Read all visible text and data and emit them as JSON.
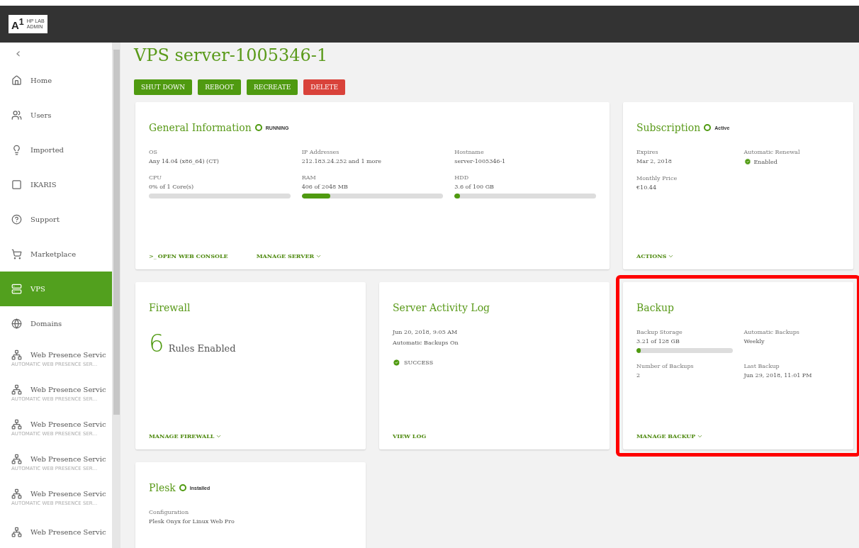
{
  "header": {
    "logo_mark": "A$^{1}$",
    "logo_lines": [
      "HP LAB",
      "ADMIN"
    ]
  },
  "sidebar": {
    "collapse": "‹",
    "items": [
      {
        "kind": "home",
        "label": "Home",
        "selected": false
      },
      {
        "kind": "users",
        "label": "Users",
        "selected": false
      },
      {
        "kind": "bulb",
        "label": "Imported",
        "selected": false
      },
      {
        "kind": "square",
        "label": "IKARIS",
        "selected": false
      },
      {
        "kind": "help",
        "label": "Support",
        "selected": false
      },
      {
        "kind": "cart",
        "label": "Marketplace",
        "selected": false
      },
      {
        "kind": "server",
        "label": "VPS",
        "selected": true
      },
      {
        "kind": "globe",
        "label": "Domains",
        "selected": false
      },
      {
        "kind": "network",
        "label": "Web Presence Servic",
        "sub": "AUTOMATIC WEB PRESENCE SER...",
        "selected": false
      },
      {
        "kind": "network",
        "label": "Web Presence Servic",
        "sub": "AUTOMATIC WEB PRESENCE SER...",
        "selected": false
      },
      {
        "kind": "network",
        "label": "Web Presence Servic",
        "sub": "AUTOMATIC WEB PRESENCE SER...",
        "selected": false
      },
      {
        "kind": "network",
        "label": "Web Presence Servic",
        "sub": "AUTOMATIC WEB PRESENCE SER...",
        "selected": false
      },
      {
        "kind": "network",
        "label": "Web Presence Servic",
        "sub": "AUTOMATIC WEB PRESENCE SER...",
        "selected": false
      },
      {
        "kind": "network",
        "label": "Web Presence Servic",
        "selected": false
      }
    ]
  },
  "title": "VPS server-1005346-1",
  "buttons": [
    {
      "label": "SHUT DOWN",
      "kind": "primary"
    },
    {
      "label": "REBOOT",
      "kind": "primary"
    },
    {
      "label": "RECREATE",
      "kind": "primary"
    },
    {
      "label": "DELETE",
      "kind": "danger"
    }
  ],
  "cards": [
    {
      "title": "General Information",
      "status": "RUNNING",
      "highlighted": false,
      "fields": [
        {
          "label": "OS",
          "value": "Any 14.04 (x86_64) (CT)"
        },
        {
          "label": "IP Addresses",
          "value": "212.183.24.252 and 1 more"
        },
        {
          "label": "Hostname",
          "value": "server-1005346-1"
        },
        {
          "label": "CPU",
          "value": "0% of 1 Core(s)",
          "level": 0
        },
        {
          "label": "RAM",
          "value": "406 of 2048 MB",
          "level": 0.2
        },
        {
          "label": "HDD",
          "value": "3.6 of 100 GB",
          "level": 0.036
        }
      ],
      "actions": [
        {
          "label": "OPEN WEB CONSOLE",
          "kind": "console",
          "prefix": ">_"
        },
        {
          "label": "MANAGE SERVER",
          "kind": "menu"
        }
      ]
    },
    {
      "title": "Subscription",
      "status": "Active",
      "highlighted": false,
      "fields": [
        {
          "label": "Expires",
          "value": "Mar 2, 2018"
        },
        {
          "label": "Automatic Renewal",
          "value": "Enabled",
          "check": true
        },
        {
          "label": "Monthly Price",
          "value": "€10.44"
        }
      ],
      "actions": [
        {
          "label": "ACTIONS",
          "kind": "menu"
        }
      ]
    },
    {
      "title": "Firewall",
      "highlighted": false,
      "big": {
        "number": "6",
        "text": "Rules Enabled"
      },
      "actions": [
        {
          "label": "MANAGE FIREWALL",
          "kind": "menu"
        }
      ]
    },
    {
      "title": "Server Activity Log",
      "highlighted": false,
      "lines": [
        "Jun 20, 2018, 9:05 AM",
        "Automatic Backups On"
      ],
      "result": "SUCCESS",
      "actions": [
        {
          "label": "VIEW LOG",
          "kind": "link"
        }
      ]
    },
    {
      "title": "Backup",
      "highlighted": true,
      "fields": [
        {
          "label": "Backup Storage",
          "value": "3.21 of 128 GB",
          "level": 0.02
        },
        {
          "label": "Automatic Backups",
          "value": "Weekly"
        },
        {
          "label": "Number of Backups",
          "value": "2"
        },
        {
          "label": "Last Backup",
          "value": "Jun 29, 2018, 11:01 PM"
        }
      ],
      "actions": [
        {
          "label": "MANAGE BACKUP",
          "kind": "menu"
        }
      ]
    },
    {
      "title": "Plesk",
      "status": "Installed",
      "highlighted": false,
      "fields": [
        {
          "label": "Configuration",
          "value": "Plesk Onyx for Linux Web Pro"
        }
      ]
    }
  ]
}
